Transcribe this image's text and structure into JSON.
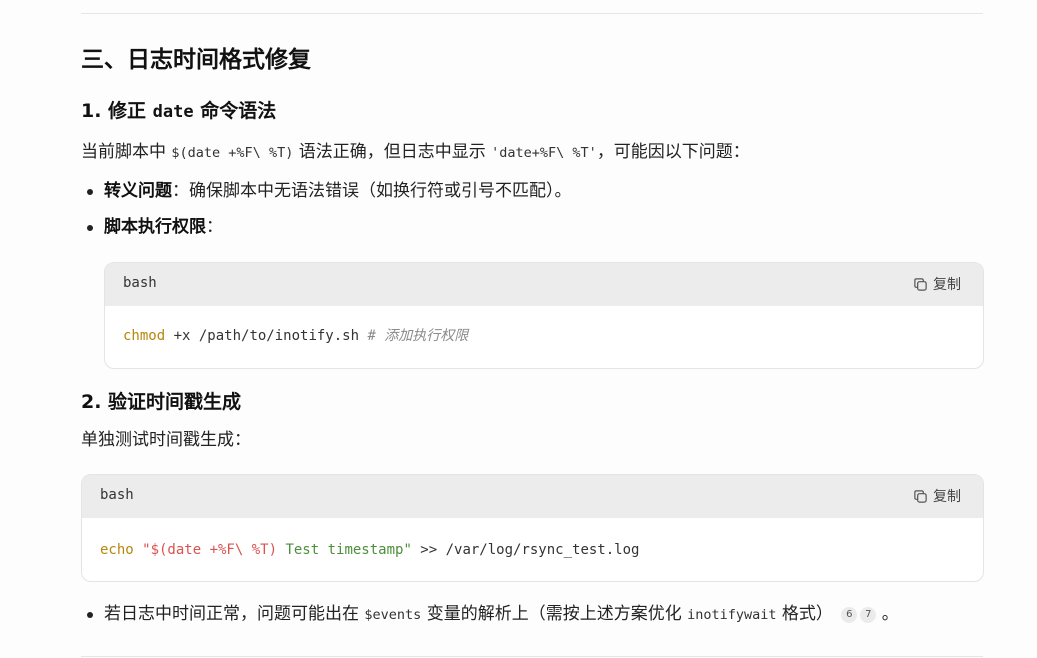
{
  "section": {
    "title": "三、日志时间格式修复"
  },
  "sub1": {
    "prefix": "1. 修正 ",
    "code": "date",
    "suffix": " 命令语法"
  },
  "para1": {
    "t1": "当前脚本中 ",
    "c1": "$(date +%F\\ %T)",
    "t2": " 语法正确，但日志中显示 ",
    "c2": "'date+%F\\ %T'",
    "t3": "，可能因以下问题："
  },
  "bullets1": [
    {
      "bold": "转义问题",
      "text": "：确保脚本中无语法错误（如换行符或引号不匹配）。"
    },
    {
      "bold": "脚本执行权限",
      "text": "："
    }
  ],
  "code1": {
    "lang": "bash",
    "copy_label": "复制",
    "cmd": "chmod",
    "args": " +x /path/to/inotify.sh  ",
    "comment": "# 添加执行权限"
  },
  "sub2": {
    "title": "2. 验证时间戳生成"
  },
  "para2": "单独测试时间戳生成：",
  "code2": {
    "lang": "bash",
    "copy_label": "复制",
    "cmd": "echo",
    "str_open": " \"$(date +%F\\ %T)",
    "str_rest": " Test timestamp\"",
    "rest": " >> /var/log/rsync_test.log"
  },
  "bullet3": {
    "t1": "若日志中时间正常，问题可能出在 ",
    "c1": "$events",
    "t2": " 变量的解析上（需按上述方案优化 ",
    "c2": "inotifywait",
    "t3": " 格式）",
    "cites": [
      "6",
      "7"
    ],
    "end": "。"
  },
  "icons": {
    "copy": "copy-icon"
  }
}
